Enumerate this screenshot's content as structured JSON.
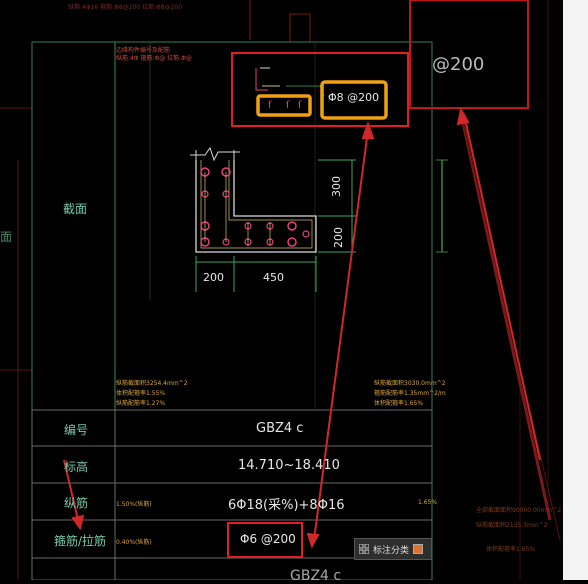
{
  "drawing": {
    "section_label": "截面",
    "left_partial_label": "面",
    "section_note_lines": [
      "边缘构件编号及配筋",
      "纵筋:4Φ 箍筋:Φ@  拉筋:Φ@"
    ],
    "top_note_line": "纵筋:4Φ16 箍筋:Φ8@200 拉筋:Φ8@200",
    "dimensions": {
      "d300": "300",
      "d200v": "200",
      "d200h": "200",
      "d450": "450"
    },
    "callout_spec": "Φ8 @200",
    "top_right_spec": "@200",
    "bottom_partial_text": "GBZ4 c"
  },
  "table": {
    "rows": [
      {
        "label": "编号",
        "value": "GBZ4 c"
      },
      {
        "label": "标高",
        "value": "14.710~18.410"
      },
      {
        "label": "纵筋",
        "value": "6Φ18(采%)+8Φ16"
      },
      {
        "label": "箍筋/拉筋",
        "value": "Φ6 @200"
      }
    ],
    "side_notes_left": [
      "纵筋截面积3254.4mm^2",
      "体积配箍率1.55%",
      "纵筋配筋率1.27%"
    ],
    "side_notes_right": [
      "纵筋截面积3030.0mm^2",
      "箍筋配筋率1.35mm^2/m",
      "体积配箍率1.65%"
    ],
    "row3_left_note": "1.50%(纵筋)",
    "row4_left_note": "0.40%(纵筋)",
    "row3_right_note": "1.65%"
  },
  "background_notes": [
    "全部截面面积90000.00mm^2",
    "纵筋截面积2135.3mm^2",
    "体积配箍率1.65%"
  ],
  "toolbar": {
    "label": "标注分类"
  },
  "colors": {
    "red_box": "#e02020",
    "orange_box": "#f0a010",
    "arrow": "#d02828",
    "line_green": "#3aa85a"
  }
}
